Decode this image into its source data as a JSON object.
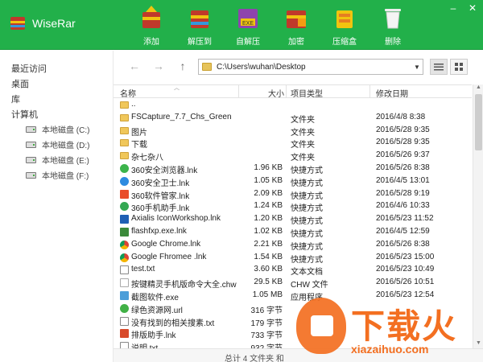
{
  "app": {
    "title": "WiseRar"
  },
  "window_controls": {
    "minimize": "–",
    "close": "✕"
  },
  "toolbar": [
    {
      "label": "添加",
      "icon": "add-archive-icon"
    },
    {
      "label": "解压到",
      "icon": "extract-to-icon"
    },
    {
      "label": "自解压",
      "icon": "self-extract-icon"
    },
    {
      "label": "加密",
      "icon": "encrypt-icon"
    },
    {
      "label": "压缩盒",
      "icon": "compress-box-icon"
    },
    {
      "label": "删除",
      "icon": "delete-icon"
    }
  ],
  "sidebar": {
    "recent": "最近访问",
    "desktop": "桌面",
    "library": "库",
    "computer": "计算机",
    "drives": [
      "本地磁盘 (C:)",
      "本地磁盘 (D:)",
      "本地磁盘 (E:)",
      "本地磁盘 (F:)"
    ]
  },
  "nav": {
    "back": "←",
    "forward": "→",
    "up": "↑"
  },
  "address": {
    "path": "C:\\Users\\wuhan\\Desktop"
  },
  "columns": {
    "name": "名称",
    "size": "大小",
    "type": "项目类型",
    "date": "修改日期"
  },
  "files": [
    {
      "icon": "folder",
      "name": "..",
      "size": "",
      "type": "",
      "date": ""
    },
    {
      "icon": "folder",
      "name": "FSCapture_7.7_Chs_Green",
      "size": "",
      "type": "文件夹",
      "date": "2016/4/8 8:38"
    },
    {
      "icon": "folder",
      "name": "图片",
      "size": "",
      "type": "文件夹",
      "date": "2016/5/28 9:35"
    },
    {
      "icon": "folder",
      "name": "下载",
      "size": "",
      "type": "文件夹",
      "date": "2016/5/28 9:35"
    },
    {
      "icon": "folder",
      "name": "杂七杂八",
      "size": "",
      "type": "文件夹",
      "date": "2016/5/26 9:37"
    },
    {
      "icon": "browser",
      "name": "360安全浏览器.lnk",
      "size": "1.96 KB",
      "type": "快捷方式",
      "date": "2016/5/26 8:38"
    },
    {
      "icon": "guard",
      "name": "360安全卫士.lnk",
      "size": "1.05 KB",
      "type": "快捷方式",
      "date": "2016/4/5 13:01"
    },
    {
      "icon": "mgr",
      "name": "360软件管家.lnk",
      "size": "2.09 KB",
      "type": "快捷方式",
      "date": "2016/5/28 9:19"
    },
    {
      "icon": "mobile",
      "name": "360手机助手.lnk",
      "size": "1.24 KB",
      "type": "快捷方式",
      "date": "2016/4/6 10:33"
    },
    {
      "icon": "axialis",
      "name": "Axialis IconWorkshop.lnk",
      "size": "1.20 KB",
      "type": "快捷方式",
      "date": "2016/5/23 11:52"
    },
    {
      "icon": "fxp",
      "name": "flashfxp.exe.lnk",
      "size": "1.02 KB",
      "type": "快捷方式",
      "date": "2016/4/5 12:59"
    },
    {
      "icon": "chrome",
      "name": "Google Chrome.lnk",
      "size": "2.21 KB",
      "type": "快捷方式",
      "date": "2016/5/26 8:38"
    },
    {
      "icon": "chrome",
      "name": "Google Fhromee .lnk",
      "size": "1.54 KB",
      "type": "快捷方式",
      "date": "2016/5/23 15:00"
    },
    {
      "icon": "txt",
      "name": "test.txt",
      "size": "3.60 KB",
      "type": "文本文档",
      "date": "2016/5/23 10:49"
    },
    {
      "icon": "chw",
      "name": "按键精灵手机版命令大全.chw",
      "size": "29.5 KB",
      "type": "CHW 文件",
      "date": "2016/5/26 10:51"
    },
    {
      "icon": "exe",
      "name": "截图软件.exe",
      "size": "1.05 MB",
      "type": "应用程序",
      "date": "2016/5/23 12:54"
    },
    {
      "icon": "url",
      "name": "绿色资源网.url",
      "size": "316 字节",
      "type": "",
      "date": ""
    },
    {
      "icon": "txt",
      "name": "没有找到的相关搜素.txt",
      "size": "179 字节",
      "type": "",
      "date": ""
    },
    {
      "icon": "lnk",
      "name": "排版助手.lnk",
      "size": "733 字节",
      "type": "",
      "date": ""
    },
    {
      "icon": "txt",
      "name": "说明.txt",
      "size": "932 字节",
      "type": "",
      "date": ""
    }
  ],
  "status": {
    "text": "总计 4 文件夹 和"
  },
  "watermark": {
    "text": "下载火",
    "url": "xiazaihuo.com"
  },
  "colors": {
    "topbar": "#22b04a",
    "watermark": "#f36f21"
  }
}
